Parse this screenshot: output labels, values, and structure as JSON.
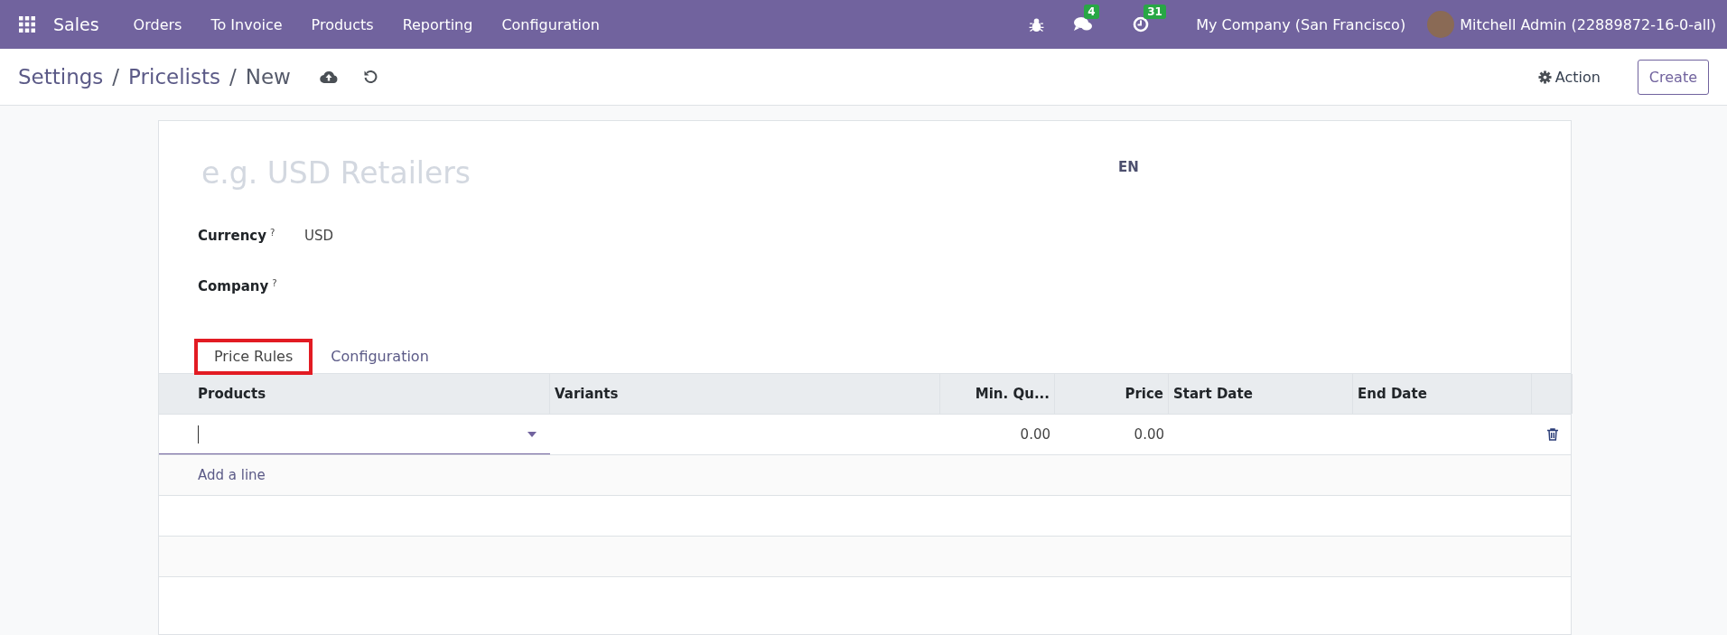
{
  "navbar": {
    "app": "Sales",
    "menu": [
      "Orders",
      "To Invoice",
      "Products",
      "Reporting",
      "Configuration"
    ],
    "messages_badge": "4",
    "activities_badge": "31",
    "company": "My Company (San Francisco)",
    "user": "Mitchell Admin (22889872-16-0-all)"
  },
  "control_panel": {
    "breadcrumbs": [
      "Settings",
      "Pricelists",
      "New"
    ],
    "separator": "/",
    "action": "Action",
    "create": "Create"
  },
  "form": {
    "name_placeholder": "e.g. USD Retailers",
    "language": "EN",
    "fields": [
      {
        "label": "Currency",
        "help": "?",
        "value": "USD"
      },
      {
        "label": "Company",
        "help": "?"
      }
    ],
    "tabs": [
      {
        "label": "Price Rules",
        "selected": true,
        "highlighted": true
      },
      {
        "label": "Configuration",
        "selected": false,
        "highlighted": false
      }
    ],
    "table": {
      "columns": [
        "Products",
        "Variants",
        "Min. Qu...",
        "Price",
        "Start Date",
        "End Date"
      ],
      "rows": [
        {
          "cells": [
            "",
            "",
            "0.00",
            "0.00",
            "",
            ""
          ],
          "editing": true
        }
      ],
      "add_line": "Add a line"
    }
  }
}
